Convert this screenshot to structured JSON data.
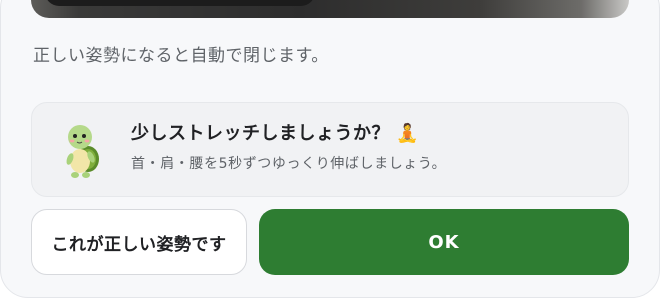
{
  "dialog": {
    "hint_text": "正しい姿勢になると自動で閉じます。"
  },
  "stretch_card": {
    "title": "少しストレッチしましょうか？",
    "title_emoji": "🧘",
    "body": "首・肩・腰を5秒ずつゆっくり伸ばしましょう。",
    "mascot_icon": "turtle-mascot-icon"
  },
  "buttons": {
    "correct_posture_label": "これが正しい姿勢です",
    "ok_label": "OK"
  },
  "colors": {
    "primary": "#2e7d32",
    "panel_background": "#f7f8fa",
    "card_background": "#f1f2f4"
  }
}
